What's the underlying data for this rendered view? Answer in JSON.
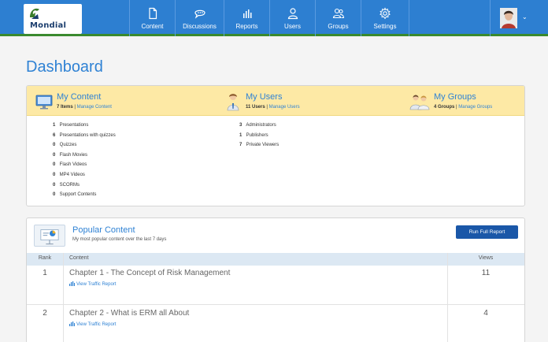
{
  "app": {
    "logo_text": "Mondial"
  },
  "nav": {
    "items": [
      {
        "label": "Content",
        "icon": "document-icon"
      },
      {
        "label": "Discussions",
        "icon": "chat-icon"
      },
      {
        "label": "Reports",
        "icon": "bar-chart-icon"
      },
      {
        "label": "Users",
        "icon": "user-icon"
      },
      {
        "label": "Groups",
        "icon": "users-group-icon"
      },
      {
        "label": "Settings",
        "icon": "gear-icon"
      }
    ]
  },
  "page": {
    "title": "Dashboard"
  },
  "summary": {
    "my_content": {
      "title": "My Content",
      "count": "7 Items",
      "sep": "|",
      "manage": "Manage Content",
      "items": [
        {
          "value": "1",
          "label": "Presentations"
        },
        {
          "value": "6",
          "label": "Presentations with quizzes"
        },
        {
          "value": "0",
          "label": "Quizzes"
        },
        {
          "value": "0",
          "label": "Flash Movies"
        },
        {
          "value": "0",
          "label": "Flash Videos"
        },
        {
          "value": "0",
          "label": "MP4 Videos"
        },
        {
          "value": "0",
          "label": "SCORMs"
        },
        {
          "value": "0",
          "label": "Support Contents"
        }
      ]
    },
    "my_users": {
      "title": "My Users",
      "count": "11 Users",
      "sep": "|",
      "manage": "Manage Users",
      "items": [
        {
          "value": "3",
          "label": "Administrators"
        },
        {
          "value": "1",
          "label": "Publishers"
        },
        {
          "value": "7",
          "label": "Private Viewers"
        }
      ]
    },
    "my_groups": {
      "title": "My Groups",
      "count": "4 Groups",
      "sep": "|",
      "manage": "Manage Groups"
    }
  },
  "popular": {
    "title": "Popular Content",
    "subtitle": "My most popular content over the last 7 days",
    "run_button": "Run Full Report",
    "columns": {
      "rank": "Rank",
      "content": "Content",
      "views": "Views"
    },
    "rows": [
      {
        "rank": "1",
        "title": "Chapter 1 - The Concept of Risk Management",
        "link": "View Traffic Report",
        "views": "11"
      },
      {
        "rank": "2",
        "title": "Chapter 2 - What is ERM all About",
        "link": "View Traffic Report",
        "views": "4"
      }
    ]
  },
  "colors": {
    "topbar": "#2d7fd1",
    "accent_green": "#3a8a2e",
    "title_blue": "#2f82d4",
    "header_yellow": "#fde9a5",
    "button_blue": "#1a57a8"
  }
}
